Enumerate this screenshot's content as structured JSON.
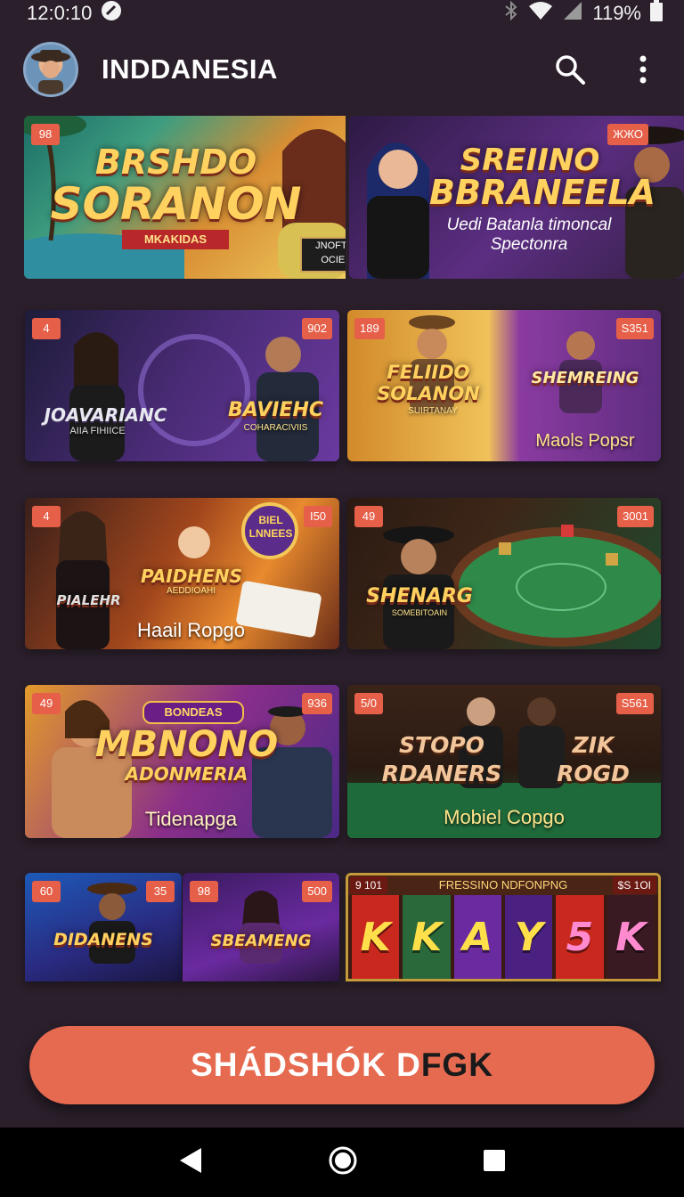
{
  "status_bar": {
    "time": "12:0:10",
    "battery": "119%"
  },
  "app_bar": {
    "title": "INDDANESIA"
  },
  "banners": [
    {
      "badge": "98",
      "title_line1": "BRSHDO",
      "title_line2": "SORANON",
      "ribbon": "MKAKIDAS",
      "caption_line1": "JNOFTAR TMRI",
      "caption_line2": "OCIERS NIDI"
    },
    {
      "badge": "ЖЖО",
      "title_line1": "SREIINO",
      "title_line2": "BBRANEELA",
      "desc_line1": "Uedi Batanla timoncal",
      "desc_line2": "Spectonra"
    }
  ],
  "tiles": [
    {
      "badges": [
        "4",
        "902"
      ],
      "title": "JOAVARIANC",
      "subtitle": "AIIA FIHIICE",
      "title2": "BAVIEHC",
      "subtitle2": "COHARACIVIIS"
    },
    {
      "badges": [
        "189",
        "S351"
      ],
      "title": "FELIIDO SOLANON",
      "subtitle": "SUIRTANAY",
      "title2": "SHEMREING",
      "label2": "Maols Popsr"
    },
    {
      "badges": [
        "4",
        "I50"
      ],
      "title": "PAIDHENS",
      "subtitle": "AEDDIOAHI",
      "title2": "PIALEHR",
      "label": "Haail Ropgo",
      "circle_text": "BIEL LNNEES"
    },
    {
      "badges": [
        "49",
        "3001"
      ],
      "title": "SHENARG",
      "subtitle": "SOMEBITOAIN"
    },
    {
      "badges": [
        "49",
        "936"
      ],
      "ribbon": "BONDEAS",
      "title": "MBNONO",
      "subtitle": "ADONMERIA",
      "label": "Tidenapga"
    },
    {
      "badges": [
        "5/0",
        "S561"
      ],
      "title": "STOPO RDANERS",
      "title2": "ZIK ROGD",
      "label": "Mobiel Copgo"
    },
    {
      "badges": [
        "60",
        "35"
      ],
      "title": "DIDANENS"
    },
    {
      "badges": [
        "98",
        "500"
      ],
      "title": "SBEAMENG"
    },
    {
      "badges": [
        "9 101",
        "$S 1OI"
      ],
      "header": "FRESSINO NDFONPNG",
      "reels": [
        "K",
        "K",
        "A",
        "Y",
        "5",
        "K"
      ]
    }
  ],
  "cta": {
    "label_light": "SHÁDSHÓK D",
    "label_dark": "FGK"
  },
  "colors": {
    "background": "#2a1f2b",
    "accent": "#e66a50",
    "badge": "#e65f48"
  }
}
